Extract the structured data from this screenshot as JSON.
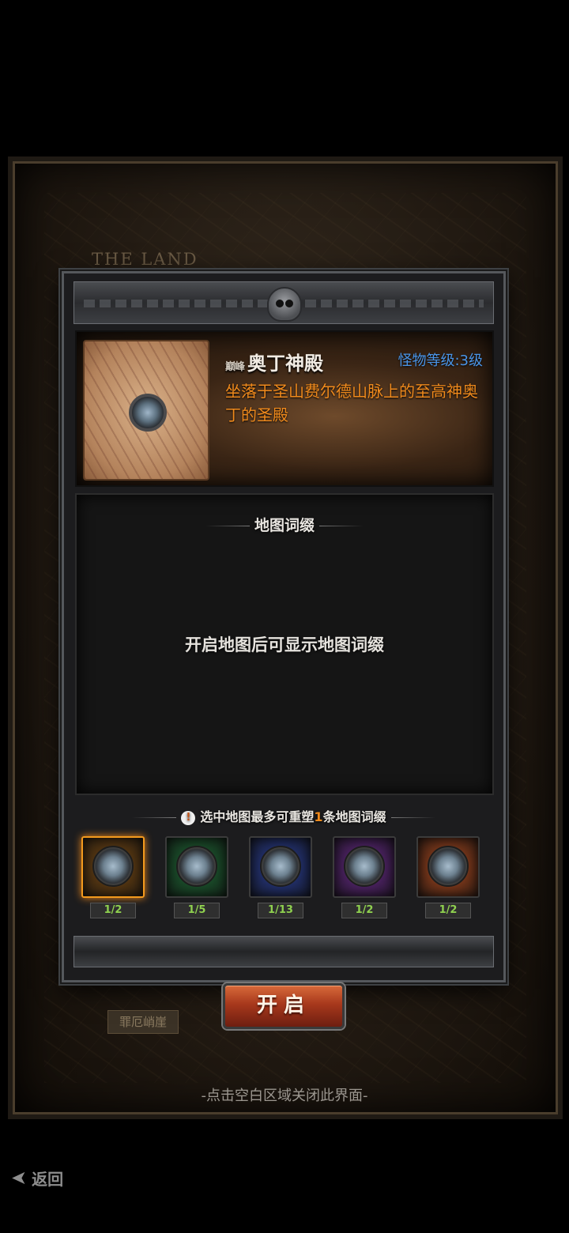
{
  "background": {
    "map_title": "THE LAND",
    "region_label": "罪厄峭崖"
  },
  "header": {
    "name_prefix": "巅峰",
    "map_name": "奥丁神殿",
    "monster_level": "怪物等级:3级",
    "description": "坐落于圣山费尔德山脉上的至高神奥丁的圣殿"
  },
  "affix_panel": {
    "title": "地图词缀",
    "empty_text": "开启地图后可显示地图词缀"
  },
  "selection": {
    "title_pre": "选中地图最多可重塑",
    "title_count": "1",
    "title_post": "条地图词缀",
    "slots": [
      {
        "count": "1/2",
        "color": "#7a4a12",
        "selected": true
      },
      {
        "count": "1/5",
        "color": "#1e6b36",
        "selected": false
      },
      {
        "count": "1/13",
        "color": "#2a3f9a",
        "selected": false
      },
      {
        "count": "1/2",
        "color": "#6a2a8c",
        "selected": false
      },
      {
        "count": "1/2",
        "color": "#b04a1e",
        "selected": false
      }
    ]
  },
  "open_button": {
    "label": "开启"
  },
  "close_hint": "-点击空白区域关闭此界面-",
  "back_button": {
    "label": "返回",
    "icon": "back-arrow-icon"
  }
}
